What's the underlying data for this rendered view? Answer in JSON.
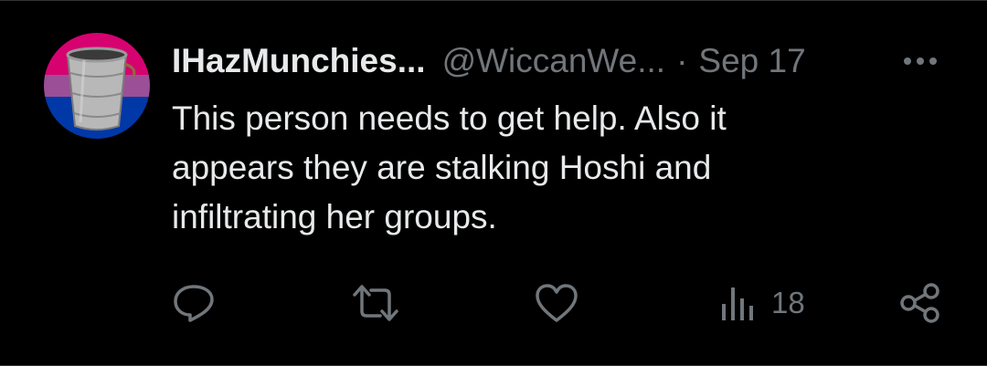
{
  "tweet": {
    "display_name": "IHazMunchies...",
    "handle": "@WiccanWe...",
    "separator": "·",
    "date": "Sep 17",
    "text_lines": [
      "This person needs to get help. Also it",
      "appears they are stalking Hoshi and",
      "infiltrating her groups."
    ],
    "views_count": "18"
  },
  "icons": {
    "more": "more-icon",
    "reply": "reply-icon",
    "retweet": "retweet-icon",
    "like": "heart-icon",
    "views": "views-icon",
    "share": "share-icon"
  },
  "colors": {
    "background": "#000000",
    "primary_text": "#e7e9ea",
    "secondary_text": "#71767b",
    "avatar_flag": [
      "#d60270",
      "#9b4f96",
      "#0038a8"
    ]
  }
}
